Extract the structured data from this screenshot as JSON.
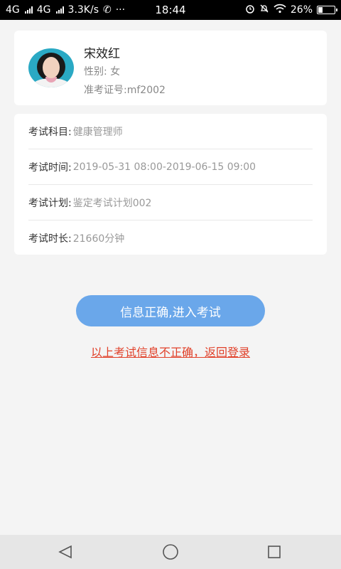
{
  "status_bar": {
    "network1": "4G",
    "network2": "4G",
    "speed": "3.3K/s",
    "more": "···",
    "time": "18:44",
    "battery": "26%",
    "battery_level": 0.26,
    "icons": [
      "signal-icon",
      "phone-icon",
      "alarm-icon",
      "mute-icon",
      "wifi-icon",
      "battery-icon"
    ]
  },
  "profile": {
    "name": "宋效红",
    "gender": "性别: 女",
    "ticket": "准考证号:mf2002",
    "avatar_icon": "person-photo"
  },
  "exam_info": [
    {
      "label": "考试科目:",
      "value": "健康管理师"
    },
    {
      "label": "考试时间:",
      "value": "2019-05-31 08:00-2019-06-15 09:00"
    },
    {
      "label": "考试计划:",
      "value": "鉴定考试计划002"
    },
    {
      "label": "考试时长:",
      "value": "21660分钟"
    }
  ],
  "actions": {
    "enter_exam": "信息正确,进入考试",
    "back_to_login": "以上考试信息不正确，返回登录"
  },
  "colors": {
    "primary_button": "#6aa7ea",
    "link_red": "#e1412a",
    "background": "#f4f4f4"
  },
  "nav_icons": [
    "back-icon",
    "home-icon",
    "recents-icon"
  ]
}
